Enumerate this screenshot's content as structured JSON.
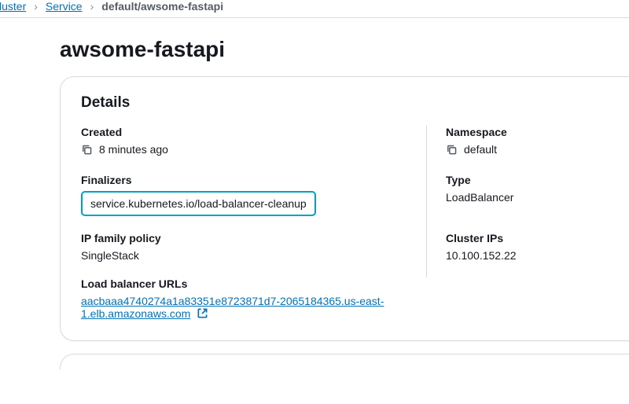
{
  "breadcrumbs": {
    "cluster": "cluster",
    "service": "Service",
    "current": "default/awsome-fastapi"
  },
  "page_title": "awsome-fastapi",
  "details": {
    "title": "Details",
    "created_label": "Created",
    "created_value": "8 minutes ago",
    "namespace_label": "Namespace",
    "namespace_value": "default",
    "finalizers_label": "Finalizers",
    "finalizers_value": "service.kubernetes.io/load-balancer-cleanup",
    "type_label": "Type",
    "type_value": "LoadBalancer",
    "ip_family_policy_label": "IP family policy",
    "ip_family_policy_value": "SingleStack",
    "cluster_ips_label": "Cluster IPs",
    "cluster_ips_value": "10.100.152.22",
    "lb_urls_label": "Load balancer URLs",
    "lb_urls_value": "aacbaaa4740274a1a83351e8723871d7-2065184365.us-east-1.elb.amazonaws.com"
  }
}
